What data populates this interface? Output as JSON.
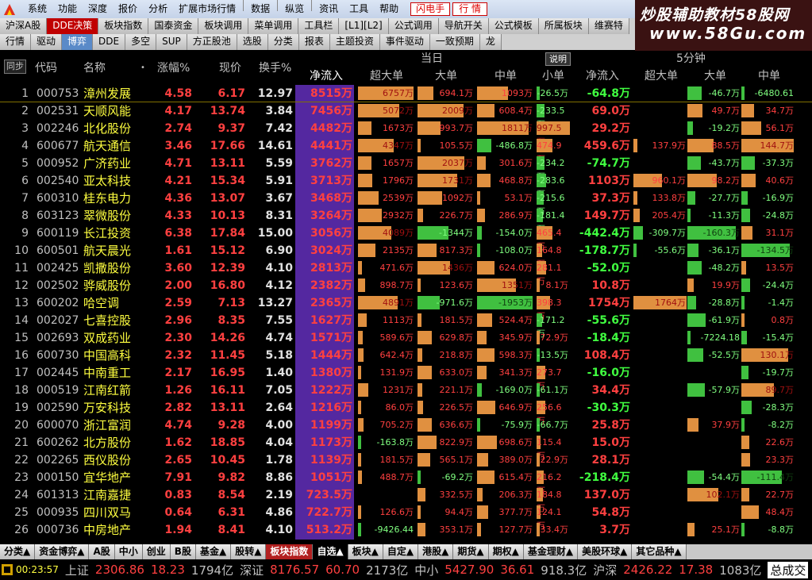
{
  "menu": {
    "items": [
      "系统",
      "功能",
      "深度",
      "报价",
      "分析",
      "扩展市场行情",
      "数据",
      "纵览",
      "资讯",
      "工具",
      "帮助"
    ],
    "btn_flash": "闪电手",
    "btn_quote": "行 情"
  },
  "watermark": {
    "line1": "炒股辅助教材58股网",
    "line2": "www.58Gu.com"
  },
  "tabs_row1": [
    "沪深A股",
    "DDE决策",
    "板块指数",
    "国泰资金",
    "板块调用",
    "菜单调用",
    "工具栏",
    "[L1][L2]",
    "公式调用",
    "导航开关",
    "公式模板",
    "所属板块",
    "维赛特"
  ],
  "tabs_row2": [
    "行情",
    "驱动",
    "博弈",
    "DDE",
    "多空",
    "SUP",
    "方正股池",
    "选股",
    "分类",
    "报表",
    "主题投资",
    "事件驱动",
    "一致预期",
    "龙"
  ],
  "header": {
    "sync": "同步",
    "code": "代码",
    "name": "名称",
    "dot": "•",
    "change": "涨幅%",
    "price": "现价",
    "turnover": "换手%",
    "today": "当日",
    "explain": "说明",
    "five_min": "5分钟",
    "sub_today": [
      "净流入",
      "超大单",
      "大单",
      "中单",
      "小单"
    ],
    "sub_five": [
      "净流入",
      "超大单",
      "大单",
      "中单"
    ]
  },
  "rows": [
    {
      "n": "1",
      "code": "000753",
      "name": "漳州发展",
      "chg": "4.58",
      "price": "6.17",
      "turn": "12.97",
      "net": "8515万",
      "sb": "6757万",
      "b": "694.1万",
      "m": "1093万",
      "s": "-26.5万",
      "net5": "-64.8万",
      "sb5": "",
      "b5": "-46.7万",
      "m5": "-6480.61"
    },
    {
      "n": "2",
      "code": "002531",
      "name": "天顺风能",
      "chg": "4.17",
      "price": "13.74",
      "turn": "3.84",
      "net": "7456万",
      "sb": "5072万",
      "b": "2009万",
      "m": "608.4万",
      "s": "-233.5万",
      "net5": "69.0万",
      "sb5": "",
      "b5": "49.7万",
      "m5": "34.7万"
    },
    {
      "n": "3",
      "code": "002246",
      "name": "北化股份",
      "chg": "2.74",
      "price": "9.37",
      "turn": "7.42",
      "net": "4482万",
      "sb": "1673万",
      "b": "993.7万",
      "m": "1811万",
      "s": "997.5万",
      "net5": "29.2万",
      "sb5": "",
      "b5": "-19.2万",
      "m5": "56.1万"
    },
    {
      "n": "4",
      "code": "600677",
      "name": "航天通信",
      "chg": "3.46",
      "price": "17.66",
      "turn": "14.61",
      "net": "4441万",
      "sb": "4347万",
      "b": "105.5万",
      "m": "-486.8万",
      "s": "474.9万",
      "net5": "459.6万",
      "sb5": "137.9万",
      "b5": "88.5万",
      "m5": "144.7万"
    },
    {
      "n": "5",
      "code": "000952",
      "name": "广济药业",
      "chg": "4.71",
      "price": "13.11",
      "turn": "5.59",
      "net": "3762万",
      "sb": "1657万",
      "b": "2037万",
      "m": "301.6万",
      "s": "-234.2万",
      "net5": "-74.7万",
      "sb5": "",
      "b5": "-43.7万",
      "m5": "-37.3万"
    },
    {
      "n": "6",
      "code": "002540",
      "name": "亚太科技",
      "chg": "4.21",
      "price": "15.34",
      "turn": "5.91",
      "net": "3713万",
      "sb": "1796万",
      "b": "1731万",
      "m": "468.8万",
      "s": "-283.6万",
      "net5": "1103万",
      "sb5": "960.1万",
      "b5": "98.2万",
      "m5": "40.6万"
    },
    {
      "n": "7",
      "code": "600310",
      "name": "桂东电力",
      "chg": "4.36",
      "price": "13.07",
      "turn": "3.67",
      "net": "3468万",
      "sb": "2539万",
      "b": "1092万",
      "m": "53.1万",
      "s": "-215.6万",
      "net5": "37.3万",
      "sb5": "133.8万",
      "b5": "-27.7万",
      "m5": "-16.9万"
    },
    {
      "n": "8",
      "code": "603123",
      "name": "翠微股份",
      "chg": "4.33",
      "price": "10.13",
      "turn": "8.31",
      "net": "3264万",
      "sb": "2932万",
      "b": "226.7万",
      "m": "286.9万",
      "s": "-181.4万",
      "net5": "149.7万",
      "sb5": "205.4万",
      "b5": "-11.3万",
      "m5": "-24.8万"
    },
    {
      "n": "9",
      "code": "600119",
      "name": "长江投资",
      "chg": "6.38",
      "price": "17.84",
      "turn": "15.00",
      "net": "3056万",
      "sb": "4089万",
      "b": "-1344万",
      "m": "-154.0万",
      "s": "465.4万",
      "net5": "-442.4万",
      "sb5": "-309.7万",
      "b5": "-160.3万",
      "m5": "31.1万"
    },
    {
      "n": "10",
      "code": "600501",
      "name": "航天晨光",
      "chg": "1.61",
      "price": "15.12",
      "turn": "6.90",
      "net": "3024万",
      "sb": "2135万",
      "b": "817.3万",
      "m": "-108.0万",
      "s": "164.8万",
      "net5": "-178.7万",
      "sb5": "-55.6万",
      "b5": "-36.1万",
      "m5": "-134.5万"
    },
    {
      "n": "11",
      "code": "002425",
      "name": "凯撒股份",
      "chg": "3.60",
      "price": "12.39",
      "turn": "4.10",
      "net": "2813万",
      "sb": "471.6万",
      "b": "1436万",
      "m": "624.0万",
      "s": "281.1万",
      "net5": "-52.0万",
      "sb5": "",
      "b5": "-48.2万",
      "m5": "13.5万"
    },
    {
      "n": "12",
      "code": "002502",
      "name": "骅威股份",
      "chg": "2.00",
      "price": "16.80",
      "turn": "4.12",
      "net": "2382万",
      "sb": "898.7万",
      "b": "123.6万",
      "m": "1351万",
      "s": "8.1万",
      "net5": "10.8万",
      "sb5": "",
      "b5": "19.9万",
      "m5": "-24.4万"
    },
    {
      "n": "13",
      "code": "600202",
      "name": "哈空调",
      "chg": "2.59",
      "price": "7.13",
      "turn": "13.27",
      "net": "2365万",
      "sb": "4891万",
      "b": "-971.6万",
      "m": "-1953万",
      "s": "398.3万",
      "net5": "1754万",
      "sb5": "1764万",
      "b5": "-28.8万",
      "m5": "-1.4万"
    },
    {
      "n": "14",
      "code": "002027",
      "name": "七喜控股",
      "chg": "2.96",
      "price": "8.35",
      "turn": "7.55",
      "net": "1627万",
      "sb": "1113万",
      "b": "181.5万",
      "m": "524.4万",
      "s": "-171.2万",
      "net5": "-55.6万",
      "sb5": "",
      "b5": "-61.9万",
      "m5": "0.8万"
    },
    {
      "n": "15",
      "code": "002693",
      "name": "双成药业",
      "chg": "2.30",
      "price": "14.26",
      "turn": "4.74",
      "net": "1571万",
      "sb": "589.6万",
      "b": "629.8万",
      "m": "345.9万",
      "s": "72.9万",
      "net5": "-18.4万",
      "sb5": "",
      "b5": "-7224.18",
      "m5": "-15.4万"
    },
    {
      "n": "16",
      "code": "600730",
      "name": "中国高科",
      "chg": "2.32",
      "price": "11.45",
      "turn": "5.18",
      "net": "1444万",
      "sb": "642.4万",
      "b": "218.8万",
      "m": "598.3万",
      "s": "-13.5万",
      "net5": "108.4万",
      "sb5": "",
      "b5": "-52.5万",
      "m5": "130.1万"
    },
    {
      "n": "17",
      "code": "002445",
      "name": "中南重工",
      "chg": "2.17",
      "price": "16.95",
      "turn": "1.40",
      "net": "1380万",
      "sb": "131.9万",
      "b": "633.0万",
      "m": "341.3万",
      "s": "273.7万",
      "net5": "-16.0万",
      "sb5": "",
      "b5": "",
      "m5": "-19.7万"
    },
    {
      "n": "18",
      "code": "000519",
      "name": "江南红箭",
      "chg": "1.26",
      "price": "16.11",
      "turn": "7.05",
      "net": "1222万",
      "sb": "1231万",
      "b": "221.1万",
      "m": "-169.0万",
      "s": "-61.1万",
      "net5": "34.4万",
      "sb5": "",
      "b5": "-57.9万",
      "m5": "89.7万"
    },
    {
      "n": "19",
      "code": "002590",
      "name": "万安科技",
      "chg": "2.82",
      "price": "13.11",
      "turn": "2.64",
      "net": "1216万",
      "sb": "86.0万",
      "b": "226.5万",
      "m": "646.9万",
      "s": "256.6万",
      "net5": "-30.3万",
      "sb5": "",
      "b5": "",
      "m5": "-28.3万"
    },
    {
      "n": "20",
      "code": "600070",
      "name": "浙江富润",
      "chg": "4.74",
      "price": "9.28",
      "turn": "4.00",
      "net": "1199万",
      "sb": "705.2万",
      "b": "636.6万",
      "m": "-75.9万",
      "s": "-66.7万",
      "net5": "25.8万",
      "sb5": "",
      "b5": "37.9万",
      "m5": "-8.2万"
    },
    {
      "n": "21",
      "code": "600262",
      "name": "北方股份",
      "chg": "1.62",
      "price": "18.85",
      "turn": "4.04",
      "net": "1173万",
      "sb": "-163.8万",
      "b": "822.9万",
      "m": "698.6万",
      "s": "115.4万",
      "net5": "15.0万",
      "sb5": "",
      "b5": "",
      "m5": "22.6万"
    },
    {
      "n": "22",
      "code": "002265",
      "name": "西仪股份",
      "chg": "2.65",
      "price": "10.45",
      "turn": "1.78",
      "net": "1139万",
      "sb": "181.5万",
      "b": "565.1万",
      "m": "389.0万",
      "s": "22.9万",
      "net5": "28.1万",
      "sb5": "",
      "b5": "",
      "m5": "23.3万"
    },
    {
      "n": "23",
      "code": "000150",
      "name": "宜华地产",
      "chg": "7.91",
      "price": "9.82",
      "turn": "8.86",
      "net": "1051万",
      "sb": "488.7万",
      "b": "-69.2万",
      "m": "615.4万",
      "s": "216.2万",
      "net5": "-218.4万",
      "sb5": "",
      "b5": "-54.4万",
      "m5": "-111.4万"
    },
    {
      "n": "24",
      "code": "601313",
      "name": "江南嘉捷",
      "chg": "0.83",
      "price": "8.54",
      "turn": "2.19",
      "net": "723.5万",
      "sb": "",
      "b": "332.5万",
      "m": "206.3万",
      "s": "184.8万",
      "net5": "137.0万",
      "sb5": "",
      "b5": "102.1万",
      "m5": "22.7万"
    },
    {
      "n": "25",
      "code": "000935",
      "name": "四川双马",
      "chg": "0.64",
      "price": "6.31",
      "turn": "4.86",
      "net": "722.7万",
      "sb": "126.6万",
      "b": "94.4万",
      "m": "377.7万",
      "s": "124.1万",
      "net5": "54.8万",
      "sb5": "",
      "b5": "",
      "m5": "48.4万"
    },
    {
      "n": "26",
      "code": "000736",
      "name": "中房地产",
      "chg": "1.94",
      "price": "8.41",
      "turn": "4.10",
      "net": "513.2万",
      "sb": "-9426.44",
      "b": "353.1万",
      "m": "127.7万",
      "s": "33.4万",
      "net5": "3.7万",
      "sb5": "",
      "b5": "25.1万",
      "m5": "-8.8万"
    }
  ],
  "bottom_tabs": [
    "分类▲",
    "资金博弈▲",
    "A股",
    "中小",
    "创业",
    "B股",
    "基金▲",
    "股转▲",
    "板块指数",
    "自选▲",
    "板块▲",
    "自定▲",
    "港股▲",
    "期货▲",
    "期权▲",
    "基金理财▲",
    "美股环球▲",
    "其它品种▲"
  ],
  "status": {
    "time": "00:23:57",
    "sh_label": "上证",
    "sh_val": "2306.86",
    "sh_chg": "18.23",
    "sh_amt": "1794亿",
    "sz_label": "深证",
    "sz_val": "8176.57",
    "sz_chg": "60.70",
    "sz_amt": "2173亿",
    "zx_label": "中小",
    "zx_val": "5427.90",
    "zx_chg": "36.61",
    "zx_amt": "918.3亿",
    "hs_label": "沪深",
    "hs_val": "2426.22",
    "hs_chg": "17.38",
    "hs_amt": "1083亿",
    "total_label": "总成交"
  },
  "colors": {
    "red": "#ff4040",
    "green": "#40ff40",
    "yellow": "#ffff40",
    "cyan": "#40c0ff",
    "bar_pos": "#e09040",
    "bar_neg": "#40c040"
  }
}
